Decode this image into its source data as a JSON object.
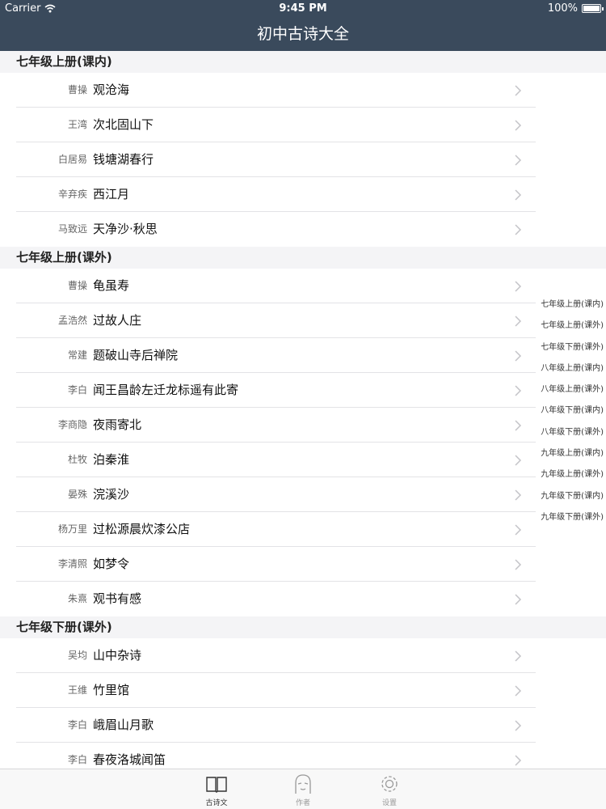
{
  "status_bar": {
    "carrier": "Carrier",
    "time": "9:45 PM",
    "battery": "100%"
  },
  "nav": {
    "title": "初中古诗大全"
  },
  "sections": [
    {
      "header": "七年级上册(课内)",
      "rows": [
        {
          "author": "曹操",
          "title": "观沧海"
        },
        {
          "author": "王湾",
          "title": "次北固山下"
        },
        {
          "author": "白居易",
          "title": "钱塘湖春行"
        },
        {
          "author": "辛弃疾",
          "title": "西江月"
        },
        {
          "author": "马致远",
          "title": "天净沙·秋思"
        }
      ]
    },
    {
      "header": "七年级上册(课外)",
      "rows": [
        {
          "author": "曹操",
          "title": "龟虽寿"
        },
        {
          "author": "孟浩然",
          "title": "过故人庄"
        },
        {
          "author": "常建",
          "title": "题破山寺后禅院"
        },
        {
          "author": "李白",
          "title": "闻王昌龄左迁龙标遥有此寄"
        },
        {
          "author": "李商隐",
          "title": "夜雨寄北"
        },
        {
          "author": "杜牧",
          "title": "泊秦淮"
        },
        {
          "author": "晏殊",
          "title": "浣溪沙"
        },
        {
          "author": "杨万里",
          "title": "过松源晨炊漆公店"
        },
        {
          "author": "李清照",
          "title": "如梦令"
        },
        {
          "author": "朱熹",
          "title": "观书有感"
        }
      ]
    },
    {
      "header": "七年级下册(课外)",
      "rows": [
        {
          "author": "吴均",
          "title": "山中杂诗"
        },
        {
          "author": "王维",
          "title": "竹里馆"
        },
        {
          "author": "李白",
          "title": "峨眉山月歌"
        },
        {
          "author": "李白",
          "title": "春夜洛城闻笛"
        }
      ]
    }
  ],
  "section_index": [
    "七年级上册(课内)",
    "七年级上册(课外)",
    "七年级下册(课外)",
    "八年级上册(课内)",
    "八年级上册(课外)",
    "八年级下册(课内)",
    "八年级下册(课外)",
    "九年级上册(课内)",
    "九年级上册(课外)",
    "九年级下册(课内)",
    "九年级下册(课外)"
  ],
  "tabs": [
    {
      "label": "古诗文",
      "icon": "book-icon",
      "active": true
    },
    {
      "label": "作者",
      "icon": "person-icon",
      "active": false
    },
    {
      "label": "设置",
      "icon": "gear-icon",
      "active": false
    }
  ]
}
